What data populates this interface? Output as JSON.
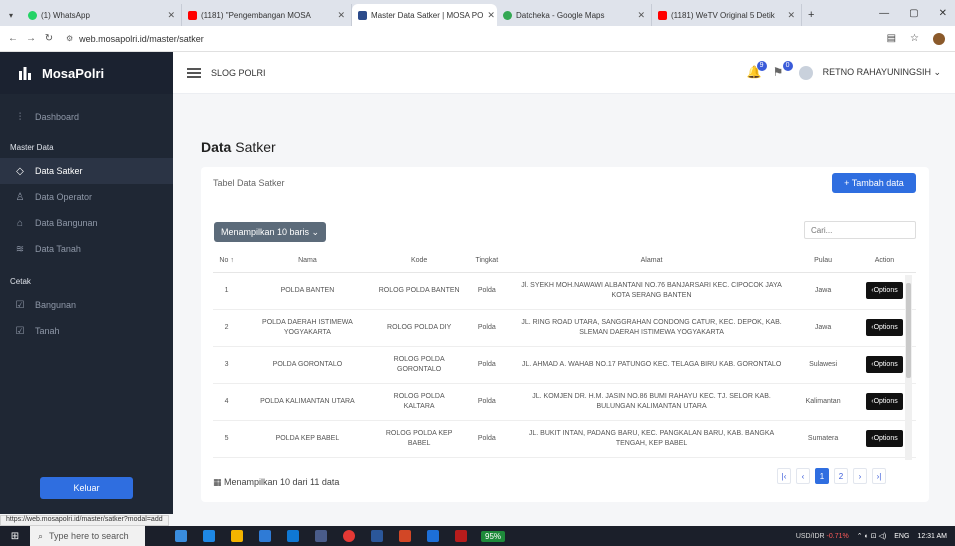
{
  "browser": {
    "tabs": [
      {
        "label": "(1) WhatsApp",
        "color": "#25d366"
      },
      {
        "label": "(1181) \"Pengembangan MOSA",
        "color": "#ff0000"
      },
      {
        "label": "Master Data Satker | MOSA PO",
        "color": "#2b4a8a"
      },
      {
        "label": "Datcheka - Google Maps",
        "color": "#34a853"
      },
      {
        "label": "(1181) WeTV Original 5 Detik",
        "color": "#ff0000"
      }
    ],
    "new_tab": "+",
    "url": "web.mosapolri.id/master/satker"
  },
  "sidebar": {
    "brand": "MosaPolri",
    "dashboard": "Dashboard",
    "section_master": "Master Data",
    "master_items": [
      "Data Satker",
      "Data Operator",
      "Data Bangunan",
      "Data Tanah"
    ],
    "section_cetak": "Cetak",
    "cetak_items": [
      "Bangunan",
      "Tanah"
    ],
    "logout": "Keluar"
  },
  "topbar": {
    "org": "SLOG POLRI",
    "notif_count": "9",
    "msg_count": "0",
    "user": "RETNO RAHAYUNINGSIH"
  },
  "page": {
    "title_bold": "Data",
    "title_rest": " Satker",
    "card_title": "Tabel Data Satker",
    "add_button": "+ Tambah data",
    "show_rows": "Menampilkan 10 baris",
    "search_placeholder": "Cari...",
    "columns": [
      "No",
      "Nama",
      "Kode",
      "Tingkat",
      "Alamat",
      "Pulau",
      "Action"
    ],
    "rows": [
      {
        "no": "1",
        "nama": "POLDA BANTEN",
        "kode": "ROLOG POLDA BANTEN",
        "tingkat": "Polda",
        "alamat": "Jl. SYEKH MOH.NAWAWI ALBANTANI NO.76 BANJARSARI KEC. CIPOCOK JAYA KOTA SERANG BANTEN",
        "pulau": "Jawa"
      },
      {
        "no": "2",
        "nama": "POLDA DAERAH ISTIMEWA YOGYAKARTA",
        "kode": "ROLOG POLDA DIY",
        "tingkat": "Polda",
        "alamat": "JL. RING ROAD UTARA, SANGGRAHAN CONDONG CATUR, KEC. DEPOK, KAB. SLEMAN DAERAH ISTIMEWA YOGYAKARTA",
        "pulau": "Jawa"
      },
      {
        "no": "3",
        "nama": "POLDA GORONTALO",
        "kode": "ROLOG POLDA GORONTALO",
        "tingkat": "Polda",
        "alamat": "JL. AHMAD A. WAHAB NO.17 PATUNGO KEC. TELAGA BIRU KAB. GORONTALO",
        "pulau": "Sulawesi"
      },
      {
        "no": "4",
        "nama": "POLDA KALIMANTAN UTARA",
        "kode": "ROLOG POLDA KALTARA",
        "tingkat": "Polda",
        "alamat": "JL. KOMJEN DR. H.M. JASIN NO.86 BUMI RAHAYU KEC. TJ. SELOR KAB. BULUNGAN KALIMANTAN UTARA",
        "pulau": "Kalimantan"
      },
      {
        "no": "5",
        "nama": "POLDA KEP BABEL",
        "kode": "ROLOG POLDA KEP BABEL",
        "tingkat": "Polda",
        "alamat": "JL. BUKIT INTAN, PADANG BARU, KEC. PANGKALAN BARU, KAB. BANGKA TENGAH, KEP BABEL",
        "pulau": "Sumatera"
      }
    ],
    "options_label": "Options",
    "footer_info": "Menampilkan 10 dari 11 data",
    "pages": [
      "1",
      "2"
    ]
  },
  "status_url": "https://web.mosapolri.id/master/satker?modal=add",
  "taskbar": {
    "search": "Type here to search",
    "battery": "95%",
    "ticker_label": "USD/IDR",
    "ticker_change": "-0.71%",
    "lang": "ENG",
    "time": "12:31 AM"
  },
  "colors": {
    "primary": "#2f6ee0",
    "sidebar": "#1f2734"
  }
}
